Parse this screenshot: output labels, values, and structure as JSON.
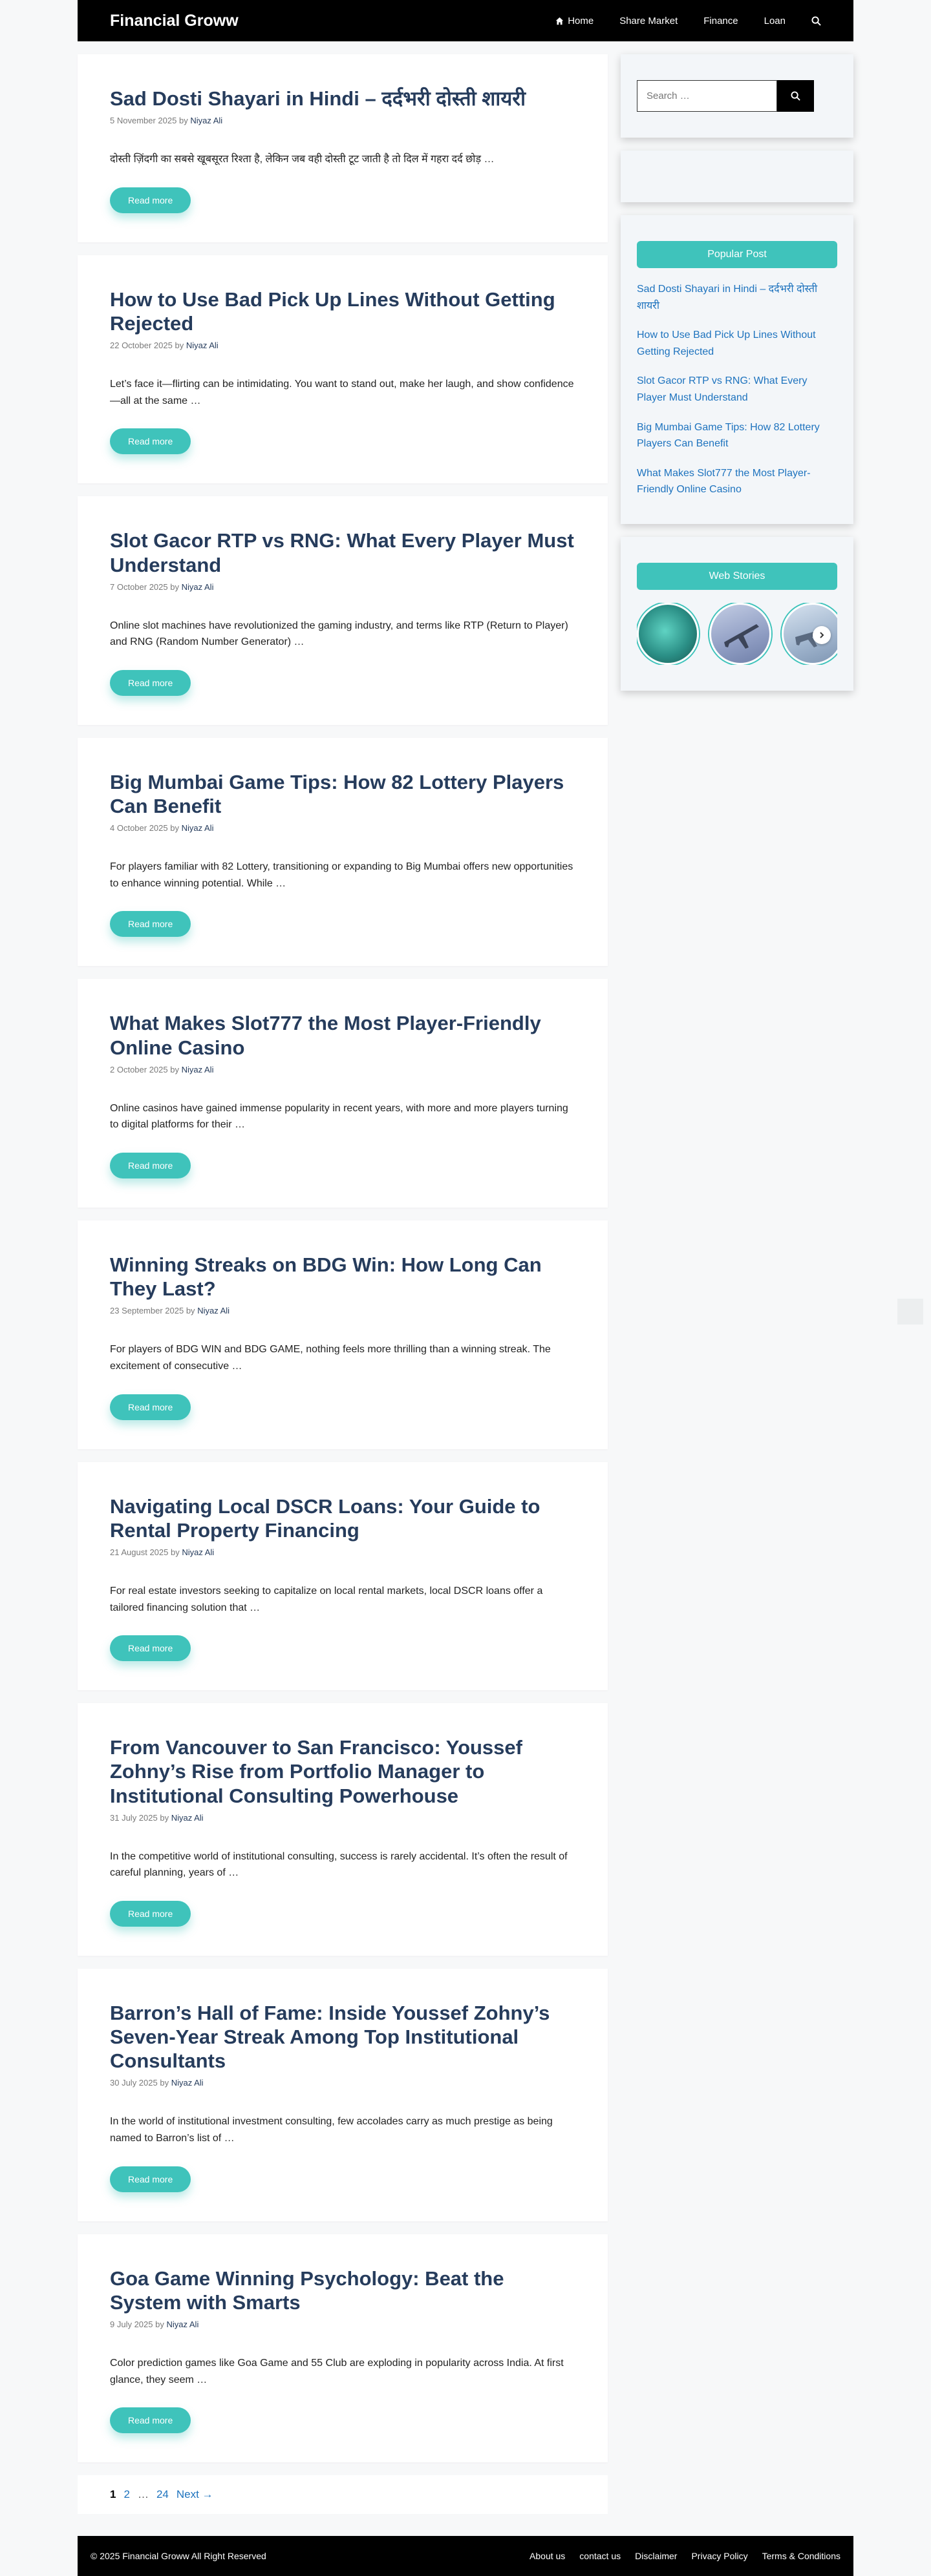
{
  "header": {
    "site_title": "Financial Groww",
    "nav": [
      {
        "label": "Home"
      },
      {
        "label": "Share Market"
      },
      {
        "label": "Finance"
      },
      {
        "label": "Loan"
      }
    ]
  },
  "posts": [
    {
      "title": "Sad Dosti Shayari in Hindi – दर्दभरी दोस्ती शायरी",
      "date": "5 November 2025",
      "by": "by",
      "author": "Niyaz Ali",
      "excerpt": "दोस्ती ज़िंदगी का सबसे खूबसूरत रिश्ता है, लेकिन जब वही दोस्ती टूट जाती है तो दिल में गहरा दर्द छोड़ …",
      "read_more": "Read more"
    },
    {
      "title": "How to Use Bad Pick Up Lines Without Getting Rejected",
      "date": "22 October 2025",
      "by": "by",
      "author": "Niyaz Ali",
      "excerpt": "Let’s face it—flirting can be intimidating. You want to stand out, make her laugh, and show confidence—all at the same …",
      "read_more": "Read more"
    },
    {
      "title": "Slot Gacor RTP vs RNG: What Every Player Must Understand",
      "date": "7 October 2025",
      "by": "by",
      "author": "Niyaz Ali",
      "excerpt": "Online slot machines have revolutionized the gaming industry, and terms like RTP (Return to Player) and RNG (Random Number Generator) …",
      "read_more": "Read more"
    },
    {
      "title": "Big Mumbai Game Tips: How 82 Lottery Players Can Benefit",
      "date": "4 October 2025",
      "by": "by",
      "author": "Niyaz Ali",
      "excerpt": "For players familiar with 82 Lottery, transitioning or expanding to Big Mumbai offers new opportunities to enhance winning potential. While …",
      "read_more": "Read more"
    },
    {
      "title": "What Makes Slot777 the Most Player-Friendly Online Casino",
      "date": "2 October 2025",
      "by": "by",
      "author": "Niyaz Ali",
      "excerpt": "Online casinos have gained immense popularity in recent years, with more and more players turning to digital platforms for their …",
      "read_more": "Read more"
    },
    {
      "title": "Winning Streaks on BDG Win: How Long Can They Last?",
      "date": "23 September 2025",
      "by": "by",
      "author": "Niyaz Ali",
      "excerpt": "For players of BDG WIN and BDG GAME, nothing feels more thrilling than a winning streak. The excitement of consecutive …",
      "read_more": "Read more"
    },
    {
      "title": "Navigating Local DSCR Loans: Your Guide to Rental Property Financing",
      "date": "21 August 2025",
      "by": "by",
      "author": "Niyaz Ali",
      "excerpt": "For real estate investors seeking to capitalize on local rental markets, local DSCR loans offer a tailored financing solution that …",
      "read_more": "Read more"
    },
    {
      "title": "From Vancouver to San Francisco: Youssef Zohny’s Rise from Portfolio Manager to Institutional Consulting Powerhouse",
      "date": "31 July 2025",
      "by": "by",
      "author": "Niyaz Ali",
      "excerpt": "In the competitive world of institutional consulting, success is rarely accidental. It’s often the result of careful planning, years of …",
      "read_more": "Read more"
    },
    {
      "title": "Barron’s Hall of Fame: Inside Youssef Zohny’s Seven-Year Streak Among Top Institutional Consultants",
      "date": "30 July 2025",
      "by": "by",
      "author": "Niyaz Ali",
      "excerpt": "In the world of institutional investment consulting, few accolades carry as much prestige as being named to Barron’s list of …",
      "read_more": "Read more"
    },
    {
      "title": "Goa Game Winning Psychology: Beat the System with Smarts",
      "date": "9 July 2025",
      "by": "by",
      "author": "Niyaz Ali",
      "excerpt": "Color prediction games like Goa Game and 55 Club are exploding in popularity across India. At first glance, they seem …",
      "read_more": "Read more"
    }
  ],
  "pagination": {
    "current": "1",
    "pages": [
      "2"
    ],
    "dots": "…",
    "last": "24",
    "next": "Next →"
  },
  "sidebar": {
    "search_placeholder": "Search …",
    "popular_heading": "Popular Post",
    "popular_posts": [
      "Sad Dosti Shayari in Hindi – दर्दभरी दोस्ती शायरी",
      "How to Use Bad Pick Up Lines Without Getting Rejected",
      "Slot Gacor RTP vs RNG: What Every Player Must Understand",
      "Big Mumbai Game Tips: How 82 Lottery Players Can Benefit",
      "What Makes Slot777 the Most Player-Friendly Online Casino"
    ],
    "stories_heading": "Web Stories"
  },
  "footer": {
    "copyright": "© 2025 Financial Groww All Right Reserved",
    "links": [
      "About us",
      "contact us",
      "Disclaimer",
      "Privacy Policy",
      "Terms & Conditions"
    ]
  },
  "icons": {
    "home": "home-icon",
    "search": "search-icon",
    "next": "chevron-right-icon"
  },
  "colors": {
    "accent": "#3fc3bb",
    "title": "#263c5c",
    "link": "#1e73be"
  }
}
